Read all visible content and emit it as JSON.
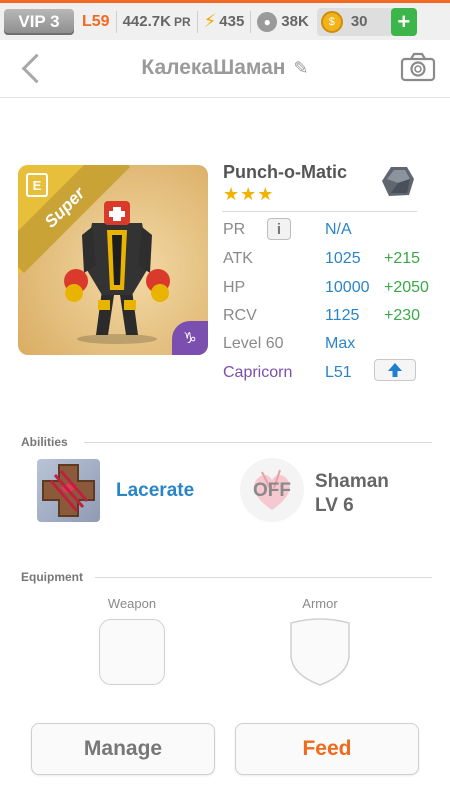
{
  "topbar": {
    "vip": "VIP 3",
    "level": "L59",
    "pr": "442.7K",
    "pr_suffix": "PR",
    "energy": "435",
    "food": "38K",
    "coins": "30",
    "add": "+"
  },
  "header": {
    "title": "КалекаШаман"
  },
  "monster": {
    "card_badge": "Super",
    "card_tag": "E",
    "zodiac_symbol": "♑",
    "name": "Punch-o-Matic",
    "stars": "★★★",
    "stats": {
      "pr_label": "PR",
      "pr_value": "N/A",
      "info": "i",
      "atk_label": "ATK",
      "atk_value": "1025",
      "atk_bonus": "+215",
      "hp_label": "HP",
      "hp_value": "10000",
      "hp_bonus": "+2050",
      "rcv_label": "RCV",
      "rcv_value": "1125",
      "rcv_bonus": "+230",
      "level_label": "Level 60",
      "level_value": "Max",
      "zodiac_label": "Capricorn",
      "zodiac_level": "L51"
    }
  },
  "abilities": {
    "title": "Abilities",
    "active_name": "Lacerate",
    "passive_state": "OFF",
    "passive_name": "Shaman",
    "passive_level": "LV 6"
  },
  "equipment": {
    "title": "Equipment",
    "weapon_label": "Weapon",
    "armor_label": "Armor"
  },
  "actions": {
    "manage": "Manage",
    "feed": "Feed"
  },
  "colors": {
    "accent_orange": "#f26a22",
    "stat_blue": "#2a85c8",
    "bonus_green": "#3aa845",
    "capricorn_purple": "#7b4fb0",
    "star_gold": "#f0b400"
  }
}
